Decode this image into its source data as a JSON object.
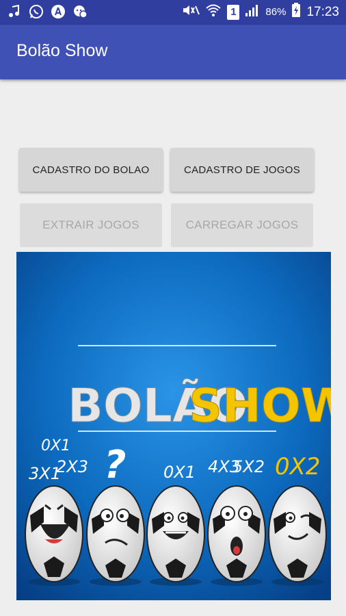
{
  "status_bar": {
    "battery_percent": "86%",
    "time": "17:23",
    "sim_slot": "1",
    "icons": [
      "audio-icon",
      "whatsapp-icon",
      "acrobat-icon",
      "chat-icon",
      "mute-icon",
      "wifi-icon",
      "sim-icon",
      "signal-icon",
      "battery-icon"
    ]
  },
  "app_bar": {
    "title": "Bolão Show"
  },
  "buttons": {
    "cadastro_bolao": "CADASTRO DO BOLAO",
    "cadastro_jogos": "CADASTRO DE JOGOS",
    "extrair_jogos": "EXTRAIR JOGOS",
    "carregar_jogos": "CARREGAR JOGOS"
  },
  "banner": {
    "title_left": "BOLÃO",
    "title_right": "SHOW",
    "scores": [
      "0X1",
      "3X1",
      "2X3",
      "?",
      "0X1",
      "4X3",
      "5X2",
      "0X2"
    ],
    "colors": {
      "background": "#0d6bbf",
      "title_left": "#e6e6e6",
      "title_right": "#f5c400"
    }
  },
  "colors": {
    "status_bar": "#303f9f",
    "app_bar": "#3f51b5",
    "page_bg": "#eeeeee"
  }
}
